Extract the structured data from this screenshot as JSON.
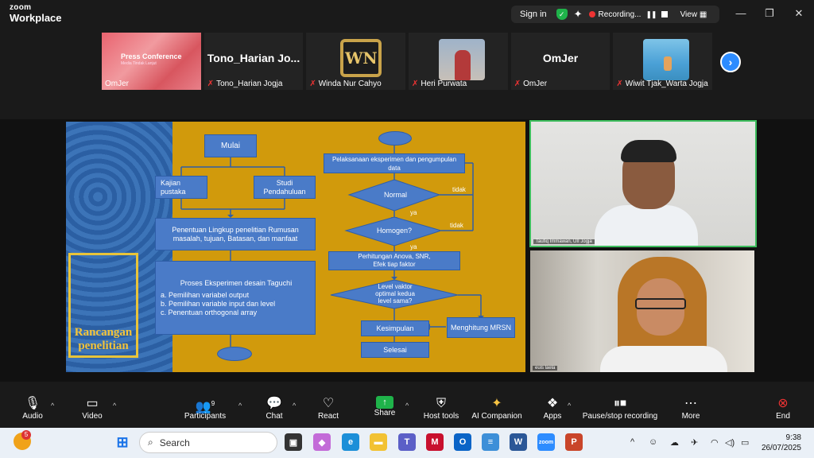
{
  "app": {
    "brand_top": "zoom",
    "brand_bottom": "Workplace"
  },
  "topbar": {
    "sign_in": "Sign in",
    "recording": "Recording...",
    "view": "View"
  },
  "gallery": {
    "tiles": [
      {
        "type": "share",
        "title": "Press Conference",
        "subtitle": "Media Tindak Lanjut",
        "name": "OmJer"
      },
      {
        "type": "text",
        "big": "Tono_Harian  Jo...",
        "name": "Tono_Harian Jogja"
      },
      {
        "type": "logo",
        "logo": "WN",
        "name": "Winda Nur Cahyo"
      },
      {
        "type": "photo",
        "name": "Heri Purwata"
      },
      {
        "type": "text",
        "big": "OmJer",
        "name": "OmJer"
      },
      {
        "type": "photo",
        "name": "Wiwit Tjak_Warta Jogja"
      }
    ]
  },
  "slide": {
    "side_title_1": "Rancangan",
    "side_title_2": "penelitian",
    "mulai": "Mulai",
    "kajian": "Kajian pustaka",
    "studi": "Studi Pendahuluan",
    "lingkup": "Penentuan Lingkup penelitian Rumusan masalah, tujuan, Batasan, dan manfaat",
    "proses_title": "Proses Eksperimen desain Taguchi",
    "proses_a": "a.  Pemilihan variabel output",
    "proses_b": "b.  Pemilihan variable input dan level",
    "proses_c": "c.  Penentuan orthogonal array",
    "pelaksanaan": "Pelaksanaan eksperimen dan pengumpulan data",
    "normal": "Normal",
    "tidak1": "tidak",
    "ya1": "ya",
    "homogen": "Homogen?",
    "tidak2": "tidak",
    "ya2": "ya",
    "perhitungan": "Perhitungan Anova, SNR, Efek tiap faktor",
    "level": "Level vaktor optimal kedua level sama?",
    "kesimpulan": "Kesimpulan",
    "mrsn": "Menghitung MRSN",
    "selesai": "Selesai"
  },
  "videos": [
    {
      "name": "Taufiq Immawan, UII Jogja"
    },
    {
      "name": "euis laela"
    }
  ],
  "toolbar": {
    "audio": "Audio",
    "video": "Video",
    "participants": "Participants",
    "participant_count": "9",
    "chat": "Chat",
    "react": "React",
    "share": "Share",
    "host_tools": "Host tools",
    "ai": "AI Companion",
    "apps": "Apps",
    "pause_stop": "Pause/stop recording",
    "more": "More",
    "end": "End"
  },
  "taskbar": {
    "search": "Search",
    "time": "9:38",
    "date": "26/07/2025",
    "weather_badge": "5"
  },
  "colors": {
    "accent": "#2d8cff",
    "green": "#1fb34a",
    "red": "#e33333",
    "slide_bg": "#d19a0c",
    "box": "#4a7bc8"
  }
}
